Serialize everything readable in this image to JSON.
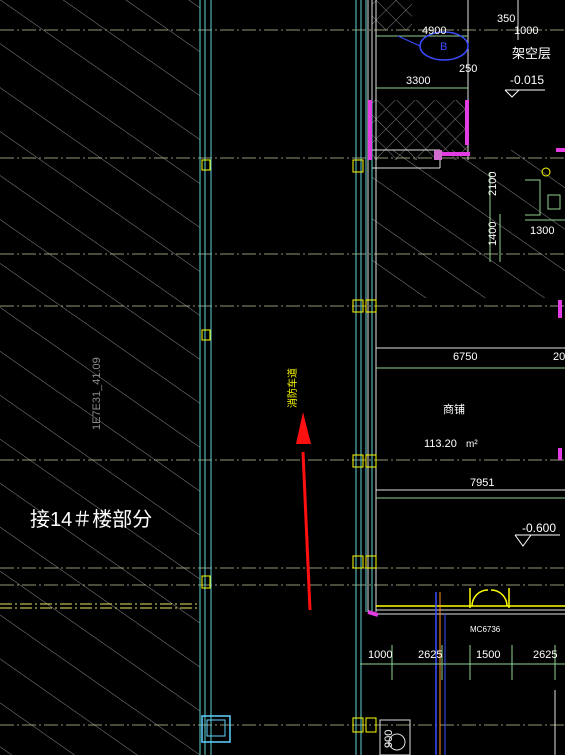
{
  "drawing": {
    "area_label": "接14＃楼部分",
    "vertical_tag": "1E7E31_41.09",
    "arrow_note": "消防车道",
    "room_name": "商铺",
    "room_area": "113.20",
    "room_area_unit": "m²",
    "level_top": "-0.015",
    "level_mid": "-0.600",
    "stilt_floor": "架空层",
    "door_tag": "MC6736"
  },
  "dimensions": {
    "top_4900": "4900",
    "top_350": "350",
    "top_1000": "1000",
    "top_3300": "3300",
    "top_250": "250",
    "side_2100": "2100",
    "side_1400": "1400",
    "side_1300": "1300",
    "mid_6750": "6750",
    "mid_20": "20",
    "mid_7951": "7951",
    "bot_1000": "1000",
    "bot_2625a": "2625",
    "bot_1500": "1500",
    "bot_2625b": "2625",
    "bot_900": "900",
    "circle_label": "B"
  },
  "colors": {
    "background": "#000000",
    "hatch": "#a8a8a8",
    "grid": "#d8d8a0",
    "wall_cyan": "#5fd3d3",
    "dim_green": "#8fd18f",
    "magenta": "#e23ce2",
    "yellow": "#ffff00",
    "blue": "#3b4cff",
    "arrow_red": "#ff1010",
    "text_white": "#ffffff"
  }
}
